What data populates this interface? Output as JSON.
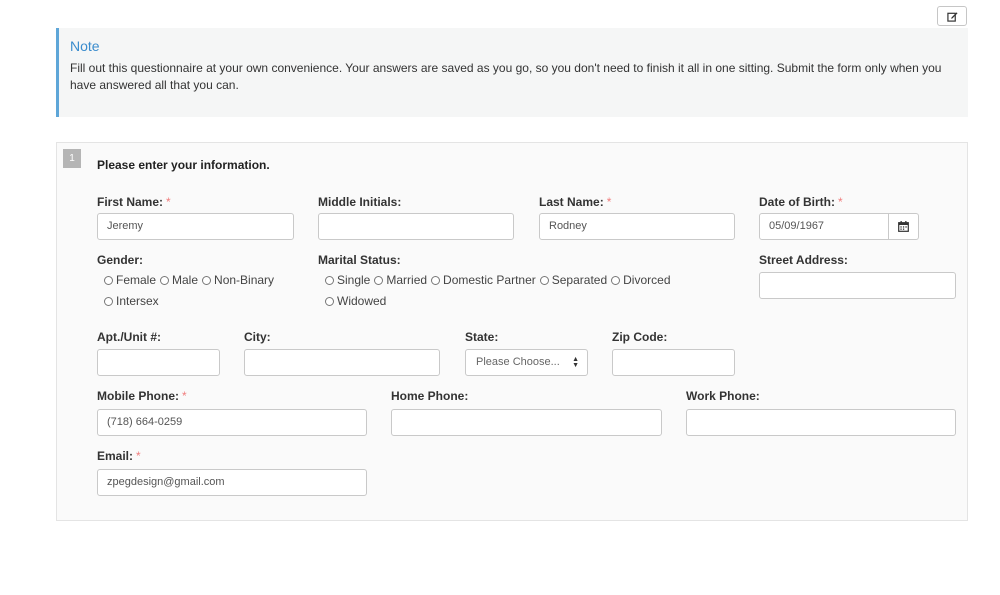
{
  "toolbar": {
    "edit_icon": "edit-icon"
  },
  "note": {
    "title": "Note",
    "body": "Fill out this questionnaire at your own convenience. Your answers are saved as you go, so you don't need to finish it all in one sitting. Submit the form only when you have answered all that you can."
  },
  "question": {
    "number": "1",
    "title": "Please enter your information."
  },
  "fields": {
    "first_name": {
      "label": "First Name:",
      "value": "Jeremy",
      "required": "*"
    },
    "middle_initials": {
      "label": "Middle Initials:",
      "value": ""
    },
    "last_name": {
      "label": "Last Name:",
      "value": "Rodney",
      "required": "*"
    },
    "dob": {
      "label": "Date of Birth:",
      "value": "05/09/1967",
      "required": "*",
      "icon": "calendar-icon"
    },
    "gender": {
      "label": "Gender:",
      "options": [
        "Female",
        "Male",
        "Non-Binary",
        "Intersex"
      ]
    },
    "marital": {
      "label": "Marital Status:",
      "options": [
        "Single",
        "Married",
        "Domestic Partner",
        "Separated",
        "Divorced",
        "Widowed"
      ]
    },
    "street": {
      "label": "Street Address:",
      "value": ""
    },
    "apt": {
      "label": "Apt./Unit #:",
      "value": ""
    },
    "city": {
      "label": "City:",
      "value": ""
    },
    "state": {
      "label": "State:",
      "selected": "Please Choose..."
    },
    "zip": {
      "label": "Zip Code:",
      "value": ""
    },
    "mobile": {
      "label": "Mobile Phone:",
      "value": "(718) 664-0259",
      "required": "*"
    },
    "home_phone": {
      "label": "Home Phone:",
      "value": ""
    },
    "work_phone": {
      "label": "Work Phone:",
      "value": ""
    },
    "email": {
      "label": "Email:",
      "value": "zpegdesign@gmail.com",
      "required": "*"
    }
  }
}
